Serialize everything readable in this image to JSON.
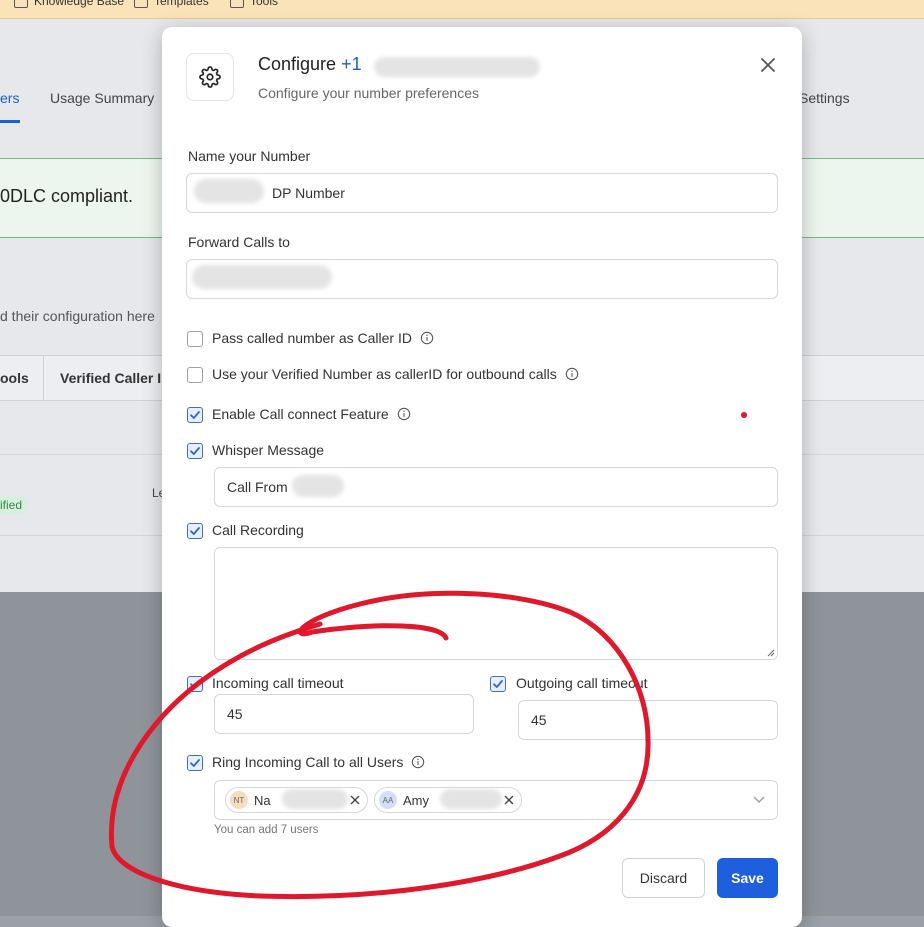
{
  "background": {
    "bookmarks": [
      "Knowledge Base",
      "Templates",
      "Tools"
    ],
    "tabs": [
      "ers",
      "Usage Summary",
      "l Settings"
    ],
    "compliance_text": "0DLC compliant.",
    "config_hint": "d their configuration here",
    "toolbar": [
      "ools",
      "Verified Caller I"
    ],
    "status_badge": "ified",
    "row_text": "Le"
  },
  "modal": {
    "title": "Configure",
    "title_number": "+1",
    "subtitle": "Configure your number preferences",
    "name_label": "Name your Number",
    "name_value": "DP Number",
    "forward_label": "Forward Calls to",
    "forward_value": "",
    "checkboxes": {
      "pass_called": {
        "label": "Pass called number as Caller ID",
        "checked": false
      },
      "verified_callerid": {
        "label": "Use your Verified Number as callerID for outbound calls",
        "checked": false
      },
      "call_connect": {
        "label": "Enable Call connect Feature",
        "checked": true
      },
      "whisper": {
        "label": "Whisper Message",
        "checked": true
      },
      "recording": {
        "label": "Call Recording",
        "checked": true
      },
      "incoming_timeout": {
        "label": "Incoming call timeout",
        "checked": true
      },
      "outgoing_timeout": {
        "label": "Outgoing call timeout",
        "checked": true
      },
      "ring_all": {
        "label": "Ring Incoming Call to all Users",
        "checked": true
      }
    },
    "whisper_value": "Call From",
    "incoming_timeout_value": "45",
    "outgoing_timeout_value": "45",
    "users": [
      {
        "initials": "NT",
        "name": "Na",
        "avatar_color": "#f8dcc0"
      },
      {
        "initials": "AA",
        "name": "Amy",
        "avatar_color": "#d6def7"
      }
    ],
    "users_hint": "You can add 7 users",
    "discard_label": "Discard",
    "save_label": "Save"
  },
  "colors": {
    "accent": "#1f5fde",
    "annotation": "#e0182c"
  }
}
